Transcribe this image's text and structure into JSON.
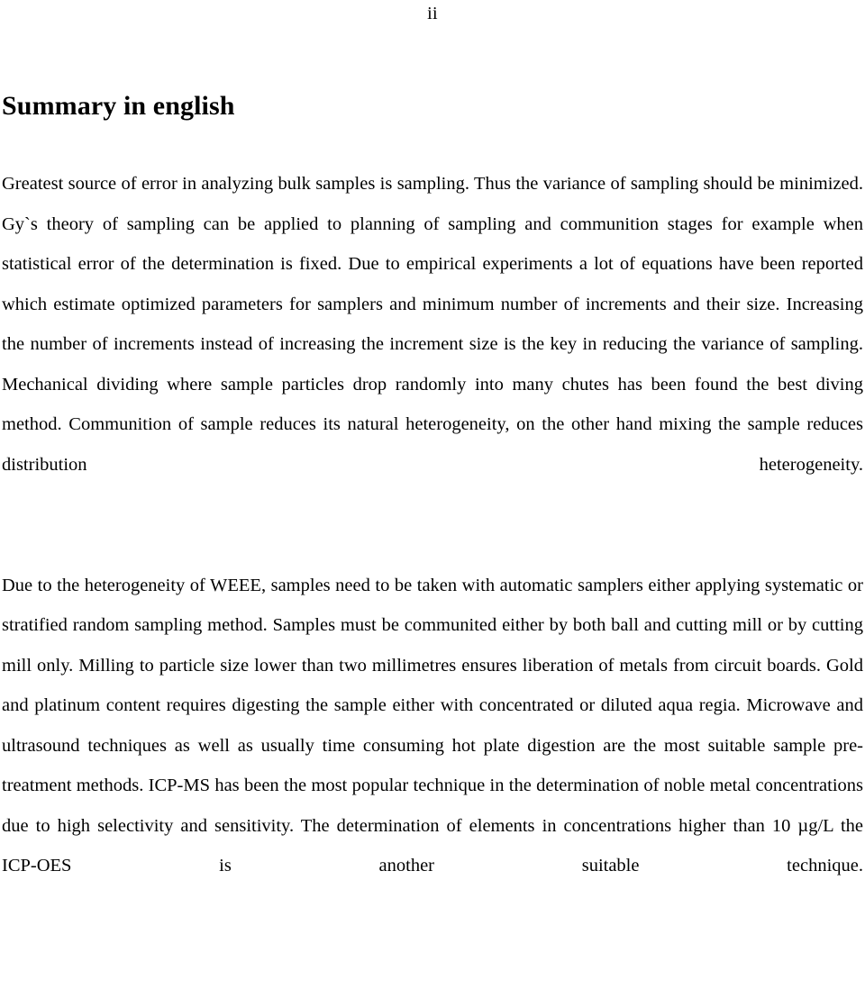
{
  "document": {
    "page_number": "ii",
    "heading": "Summary in english",
    "paragraphs": [
      "Greatest source of error in analyzing bulk samples is sampling. Thus the variance of sampling should be minimized. Gy`s theory of sampling can be applied to planning of sampling and communition stages for example when statistical error of the determination is fixed. Due to empirical experiments a lot of equations have been reported which estimate optimized parameters for samplers and minimum number of increments and their size. Increasing the number of increments instead of increasing the increment size is the key in reducing the variance of sampling. Mechanical dividing where sample particles drop randomly into many chutes has been found the best diving method. Communition of sample reduces its natural heterogeneity, on the other hand mixing the sample reduces distribution heterogeneity.",
      "Due to the heterogeneity of WEEE, samples need to be taken with automatic samplers either applying systematic or stratified random sampling method. Samples must be communited either by both ball and cutting mill or by cutting mill only. Milling to particle size lower than two millimetres ensures liberation of metals from circuit boards. Gold and platinum content requires digesting the sample either with concentrated or diluted aqua regia. Microwave and ultrasound techniques as well as usually time consuming hot plate digestion are the most suitable sample pre-treatment methods. ICP-MS has been the most popular technique in the determination of noble metal concentrations due to high selectivity and sensitivity. The determination of elements in concentrations higher than 10 µg/L the ICP-OES  is another suitable technique."
    ]
  },
  "colors": {
    "page_background": "#ffffff",
    "text": "#000000"
  }
}
